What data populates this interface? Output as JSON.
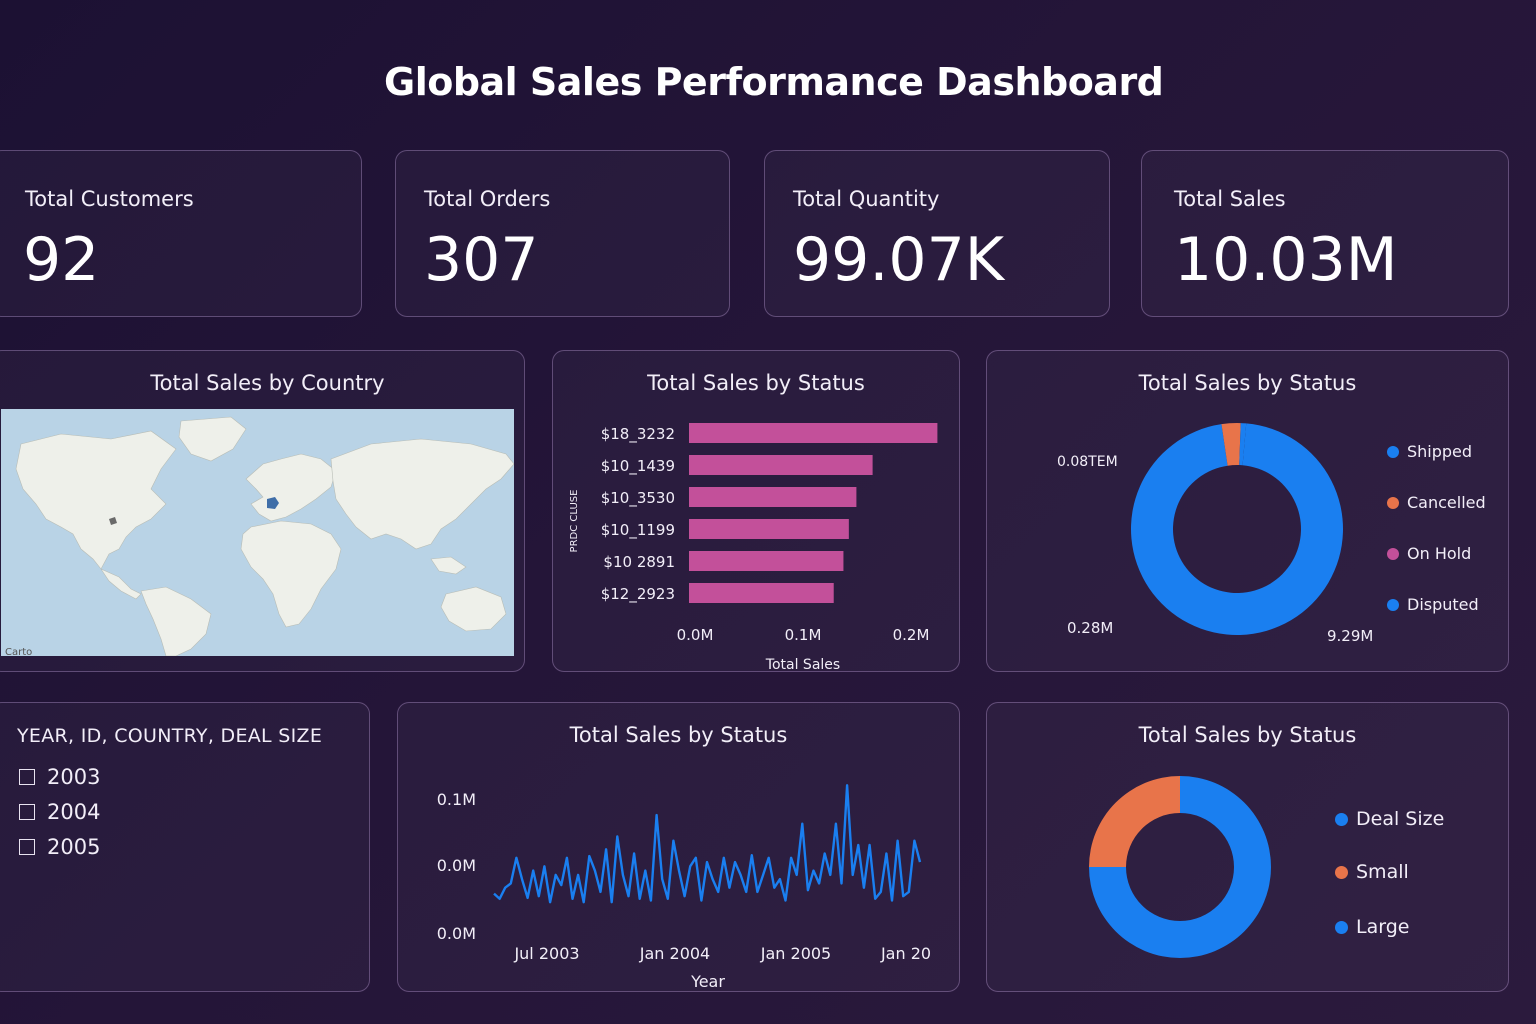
{
  "header": {
    "title": "Global Sales Performance Dashboard"
  },
  "kpis": [
    {
      "label": "Total Customers",
      "value": "92"
    },
    {
      "label": "Total Orders",
      "value": "307"
    },
    {
      "label": "Total Quantity",
      "value": "99.07K"
    },
    {
      "label": "Total Sales",
      "value": "10.03M"
    }
  ],
  "map_panel": {
    "title": "Total Sales by Country",
    "credit": "Carto"
  },
  "bar_panel": {
    "title": "Total Sales by Status",
    "ylabel": "PRDC CLUSE",
    "xlabel": "Total Sales",
    "bar_color": "#c3509a"
  },
  "donut1_panel": {
    "title": "Total Sales by Status",
    "labels": {
      "top_left": "0.08TEM",
      "bottom_left": "0.28M",
      "bottom_right": "9.29M"
    },
    "legend": [
      {
        "label": "Shipped",
        "color": "#1a7ff0"
      },
      {
        "label": "Cancelled",
        "color": "#e8744a"
      },
      {
        "label": "On Hold",
        "color": "#c3509a"
      },
      {
        "label": "Disputed",
        "color": "#1a7ff0"
      }
    ]
  },
  "filter_panel": {
    "title": "YEAR, ID, COUNTRY, DEAL SIZE",
    "options": [
      {
        "label": "2003",
        "checked": false
      },
      {
        "label": "2004",
        "checked": false
      },
      {
        "label": "2005",
        "checked": false
      }
    ]
  },
  "line_panel": {
    "title": "Total Sales by Status",
    "xlabel": "Year",
    "line_color": "#1a7ff0"
  },
  "donut2_panel": {
    "title": "Total Sales by Status",
    "legend": [
      {
        "label": "Deal Size",
        "color": "#1a7ff0"
      },
      {
        "label": "Small",
        "color": "#e8744a"
      },
      {
        "label": "Large",
        "color": "#1a7ff0"
      }
    ]
  },
  "chart_data": [
    {
      "type": "bar",
      "orientation": "horizontal",
      "title": "Total Sales by Status",
      "xlabel": "Total Sales",
      "ylabel": "PRDC CLUSE",
      "categories": [
        "$18_3232",
        "$10_1439",
        "$10_3530",
        "$10_1199",
        "$10 2891",
        "$12_2923"
      ],
      "values": [
        0.23,
        0.17,
        0.155,
        0.148,
        0.143,
        0.134
      ],
      "xticks": [
        "0.0M",
        "0.1M",
        "0.2M"
      ],
      "xlim": [
        0,
        0.2
      ]
    },
    {
      "type": "pie",
      "style": "donut",
      "title": "Total Sales by Status",
      "slices": [
        {
          "label": "Shipped",
          "value": 9.29,
          "color": "#1a7ff0"
        },
        {
          "label": "Cancelled",
          "value": 0.28,
          "color": "#e8744a"
        },
        {
          "label": "On Hold",
          "value": 0.08,
          "color": "#1a7ff0"
        }
      ],
      "value_labels": [
        "9.29M",
        "0.28M",
        "0.08TEM"
      ]
    },
    {
      "type": "line",
      "title": "Total Sales by Status",
      "xlabel": "Year",
      "yticks": [
        "0.1M",
        "0.0M",
        "0.0M"
      ],
      "xticks": [
        "Jul 2003",
        "Jan 2004",
        "Jan 2005",
        "Jan 20"
      ],
      "series": [
        {
          "values": [
            0.018,
            0.012,
            0.025,
            0.03,
            0.06,
            0.035,
            0.013,
            0.045,
            0.015,
            0.05,
            0.008,
            0.04,
            0.028,
            0.06,
            0.012,
            0.04,
            0.008,
            0.062,
            0.045,
            0.02,
            0.07,
            0.008,
            0.085,
            0.04,
            0.015,
            0.065,
            0.012,
            0.045,
            0.01,
            0.11,
            0.035,
            0.012,
            0.08,
            0.045,
            0.015,
            0.05,
            0.06,
            0.01,
            0.055,
            0.035,
            0.02,
            0.06,
            0.025,
            0.055,
            0.04,
            0.02,
            0.063,
            0.02,
            0.04,
            0.06,
            0.025,
            0.035,
            0.01,
            0.06,
            0.04,
            0.1,
            0.022,
            0.045,
            0.03,
            0.065,
            0.04,
            0.1,
            0.03,
            0.145,
            0.04,
            0.075,
            0.025,
            0.075,
            0.012,
            0.02,
            0.065,
            0.01,
            0.08,
            0.015,
            0.02,
            0.08,
            0.055
          ]
        }
      ]
    },
    {
      "type": "pie",
      "style": "donut",
      "title": "Total Sales by Status",
      "slices": [
        {
          "label": "Deal Size",
          "value": 75,
          "color": "#1a7ff0"
        },
        {
          "label": "Small",
          "value": 25,
          "color": "#e8744a"
        }
      ]
    }
  ]
}
